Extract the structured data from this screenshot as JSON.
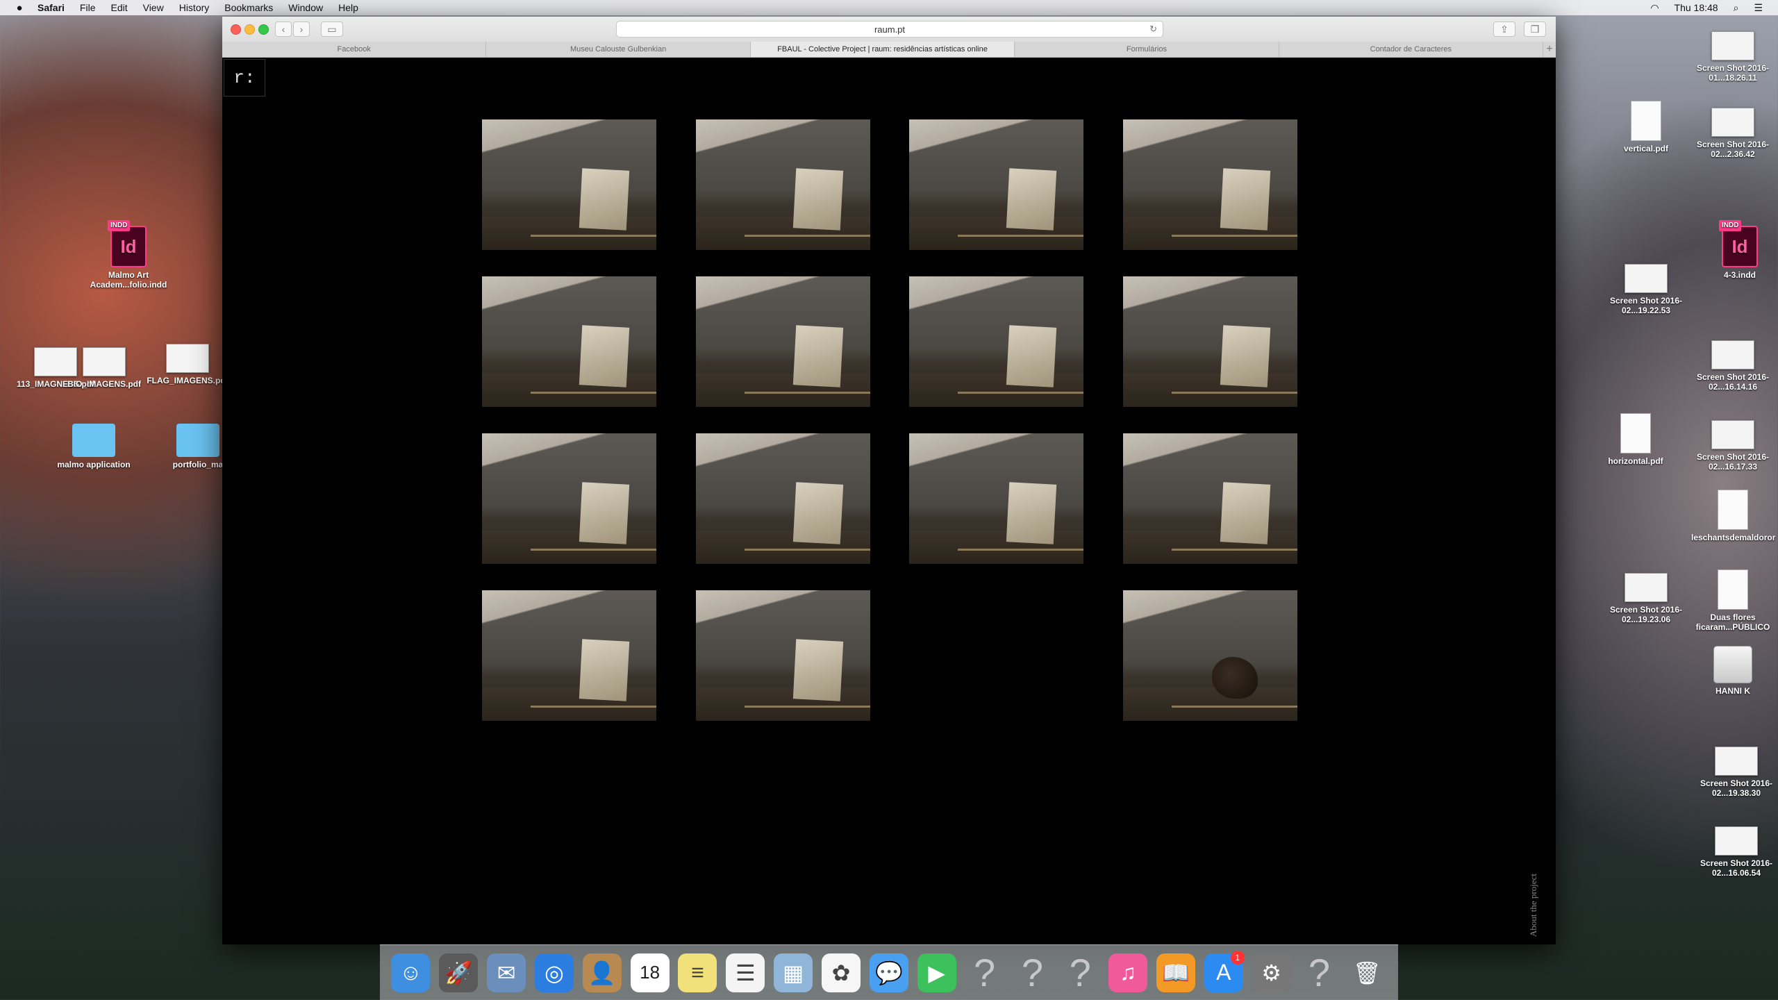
{
  "menubar": {
    "app": "Safari",
    "items": [
      "File",
      "Edit",
      "View",
      "History",
      "Bookmarks",
      "Window",
      "Help"
    ],
    "clock": "Thu 18:48"
  },
  "desktop": {
    "left_icons": [
      {
        "label": "Malmo Art Academ...folio.indd",
        "kind": "indd",
        "tag": "INDD"
      },
      {
        "label": "113_IMAGNESS.pdf",
        "kind": "shot"
      },
      {
        "label": "BIO_IMAGENS.pdf",
        "kind": "shot"
      },
      {
        "label": "FLAG_IMAGENS.pdf",
        "kind": "shot"
      },
      {
        "label": "malmo application",
        "kind": "folder"
      },
      {
        "label": "portfolio_ma",
        "kind": "folder"
      }
    ],
    "right_icons": [
      {
        "label": "Screen Shot 2016-01...18.26.11",
        "kind": "shot"
      },
      {
        "label": "vertical.pdf",
        "kind": "doc"
      },
      {
        "label": "Screen Shot 2016-02...2.36.42",
        "kind": "shot"
      },
      {
        "label": "4-3.indd",
        "kind": "indd",
        "tag": "INDD"
      },
      {
        "label": "Screen Shot 2016-02...19.22.53",
        "kind": "shot"
      },
      {
        "label": "Screen Shot 2016-02...16.14.16",
        "kind": "shot"
      },
      {
        "label": "horizontal.pdf",
        "kind": "doc"
      },
      {
        "label": "Screen Shot 2016-02...16.17.33",
        "kind": "shot"
      },
      {
        "label": "leschantsdemaldoror",
        "kind": "doc"
      },
      {
        "label": "Screen Shot 2016-02...19.23.06",
        "kind": "shot"
      },
      {
        "label": "Duas flores ficaram...PÚBLICO",
        "kind": "doc"
      },
      {
        "label": "HANNI K",
        "kind": "drive"
      },
      {
        "label": "Screen Shot 2016-02...19.38.30",
        "kind": "shot"
      },
      {
        "label": "Screen Shot 2016-02...16.06.54",
        "kind": "shot"
      }
    ]
  },
  "browser": {
    "url": "raum.pt",
    "tabs": [
      {
        "label": "Facebook",
        "active": false
      },
      {
        "label": "Museu Calouste Gulbenkian",
        "active": false
      },
      {
        "label": "FBAUL - Colective Project | raum: residências artísticas online",
        "active": true
      },
      {
        "label": "Formulários",
        "active": false
      },
      {
        "label": "Contador de Caracteres",
        "active": false
      }
    ],
    "logo": "r:",
    "about_link": "About the project",
    "gallery": [
      {
        "variant": "paper"
      },
      {
        "variant": "paper"
      },
      {
        "variant": "paper"
      },
      {
        "variant": "paper"
      },
      {
        "variant": "paper"
      },
      {
        "variant": "paper"
      },
      {
        "variant": "paper"
      },
      {
        "variant": "paper"
      },
      {
        "variant": "paper"
      },
      {
        "variant": "paper"
      },
      {
        "variant": "paper"
      },
      {
        "variant": "paper"
      },
      {
        "variant": "paper"
      },
      {
        "variant": "paper"
      },
      {
        "variant": "empty"
      },
      {
        "variant": "rock"
      }
    ]
  },
  "dock": {
    "apps": [
      {
        "name": "finder-icon",
        "glyph": "☺",
        "color": "#3e8fe0"
      },
      {
        "name": "launchpad-icon",
        "glyph": "🚀",
        "color": "#5a5a5a"
      },
      {
        "name": "mail-icon",
        "glyph": "✉",
        "color": "#6b8fbd"
      },
      {
        "name": "safari-icon",
        "glyph": "◎",
        "color": "#2b7de0"
      },
      {
        "name": "contacts-icon",
        "glyph": "👤",
        "color": "#b88950"
      },
      {
        "name": "calendar-icon",
        "glyph": "18",
        "color": "#ffffff"
      },
      {
        "name": "notes-icon",
        "glyph": "≡",
        "color": "#f2e07a"
      },
      {
        "name": "reminders-icon",
        "glyph": "☰",
        "color": "#f4f4f4"
      },
      {
        "name": "preview-icon",
        "glyph": "▦",
        "color": "#8fb6d8"
      },
      {
        "name": "photos-icon",
        "glyph": "✿",
        "color": "#f6f6f6"
      },
      {
        "name": "messages-icon",
        "glyph": "💬",
        "color": "#4aa0f0"
      },
      {
        "name": "facetime-icon",
        "glyph": "▶",
        "color": "#3cc15c"
      },
      {
        "name": "unknown-app-icon",
        "glyph": "?",
        "color": "transparent"
      },
      {
        "name": "unknown-app-icon",
        "glyph": "?",
        "color": "transparent"
      },
      {
        "name": "unknown-app-icon",
        "glyph": "?",
        "color": "transparent"
      },
      {
        "name": "itunes-icon",
        "glyph": "♫",
        "color": "#f05a9b"
      },
      {
        "name": "ibooks-icon",
        "glyph": "📖",
        "color": "#f29a25"
      },
      {
        "name": "app-store-icon",
        "glyph": "A",
        "color": "#2c8bf0",
        "badge": "1"
      },
      {
        "name": "system-preferences-icon",
        "glyph": "⚙",
        "color": "#777777"
      },
      {
        "name": "unknown-app-icon",
        "glyph": "?",
        "color": "transparent"
      },
      {
        "name": "trash-icon",
        "glyph": "🗑",
        "color": "transparent"
      }
    ]
  }
}
